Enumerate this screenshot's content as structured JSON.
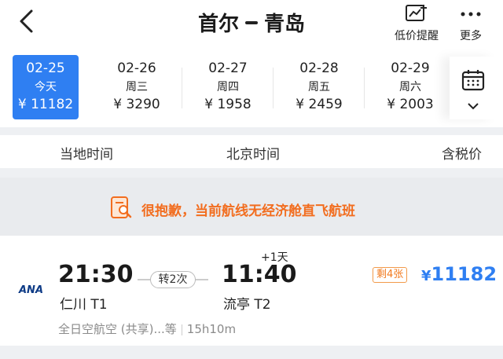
{
  "header": {
    "origin": "首尔",
    "destination": "青岛",
    "price_alert_label": "低价提醒",
    "more_label": "更多"
  },
  "dates": [
    {
      "date": "02-25",
      "weekday": "今天",
      "price": "¥ 11182",
      "selected": true
    },
    {
      "date": "02-26",
      "weekday": "周三",
      "price": "¥ 3290"
    },
    {
      "date": "02-27",
      "weekday": "周四",
      "price": "¥ 1958"
    },
    {
      "date": "02-28",
      "weekday": "周五",
      "price": "¥ 2459"
    },
    {
      "date": "02-29",
      "weekday": "周六",
      "price": "¥ 2003"
    }
  ],
  "column_headers": {
    "local_time": "当地时间",
    "beijing_time": "北京时间",
    "tax_included": "含税价"
  },
  "notice": "很抱歉，当前航线无经济舱直飞航班",
  "flight": {
    "airline_logo": "ANA",
    "dep_time": "21:30",
    "dep_airport": "仁川 T1",
    "transfer": "转2次",
    "arr_time": "11:40",
    "plus_day": "+1天",
    "arr_airport": "流亭 T2",
    "seats_left": "剩4张",
    "currency": "¥",
    "price": "11182",
    "airline_name": "全日空航空 (共享)...等",
    "duration": "15h10m"
  },
  "colors": {
    "accent": "#2f7ff2",
    "warning": "#f26d1f"
  }
}
